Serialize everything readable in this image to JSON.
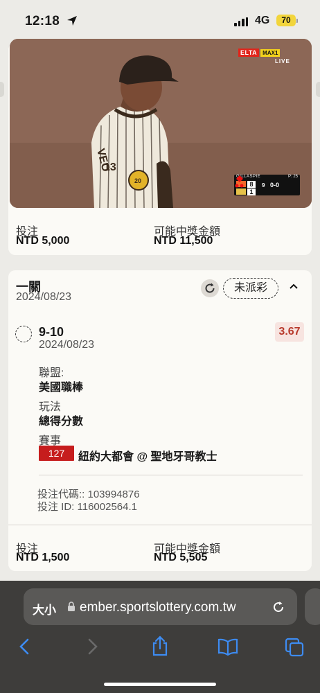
{
  "status_bar": {
    "time": "12:18",
    "network": "4G",
    "battery": "70"
  },
  "video": {
    "broadcast_logo": "ELTA",
    "channel_badge": "MAX1",
    "live": "LIVE",
    "scorebug": {
      "pitcher": "GILLASPIE",
      "pitch_count": "P: 25",
      "away_score": "8",
      "home_score": "1",
      "inning": "9",
      "count": "0-0"
    }
  },
  "top_card": {
    "stake_label": "投注",
    "stake_value": "NTD 5,000",
    "payout_label": "可能中獎金額",
    "payout_value": "NTD 11,500"
  },
  "bet": {
    "type": "一關",
    "date": "2024/08/23",
    "status": "未派彩",
    "selection": "9-10",
    "selection_date": "2024/08/23",
    "odds": "3.67",
    "league_label": "聯盟:",
    "league_value": "美國職棒",
    "market_label": "玩法",
    "market_value": "總得分數",
    "event_label": "賽事",
    "event_number": "127",
    "event_name": "紐約大都會 @ 聖地牙哥教士",
    "bet_code": "投注代碼:: 103994876",
    "bet_id": "投注 ID: 116002564.1",
    "stake_label": "投注",
    "stake_value": "NTD 1,500",
    "payout_label": "可能中獎金額",
    "payout_value": "NTD 5,505"
  },
  "browser": {
    "text_size": "大小",
    "url": "ember.sportslottery.com.tw"
  },
  "colors": {
    "accent_red": "#c61d1d",
    "odds_text": "#b83a2c"
  }
}
